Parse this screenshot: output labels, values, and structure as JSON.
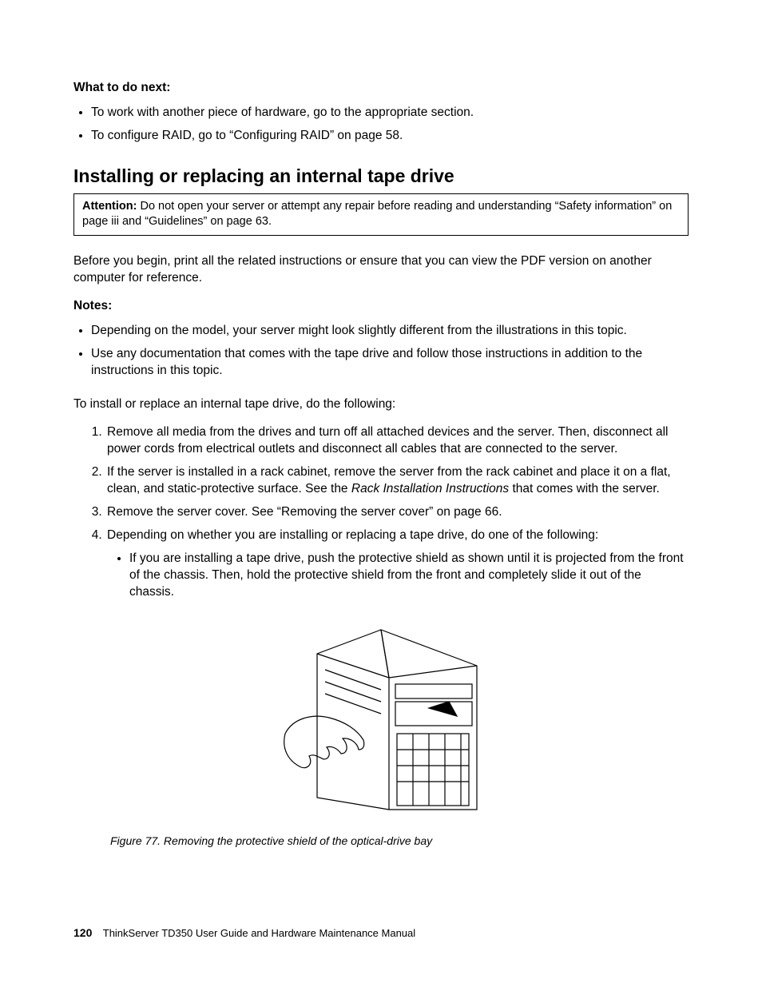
{
  "whatNext": {
    "heading": "What to do next:",
    "items": [
      "To work with another piece of hardware, go to the appropriate section.",
      "To configure RAID, go to “Configuring RAID” on page 58."
    ]
  },
  "mainHeading": "Installing or replacing an internal tape drive",
  "attention": {
    "label": "Attention:",
    "text": " Do not open your server or attempt any repair before reading and understanding “Safety information” on page iii and “Guidelines” on page 63."
  },
  "intro": "Before you begin, print all the related instructions or ensure that you can view the PDF version on another computer for reference.",
  "notes": {
    "heading": "Notes:",
    "items": [
      "Depending on the model, your server might look slightly different from the illustrations in this topic.",
      "Use any documentation that comes with the tape drive and follow those instructions in addition to the instructions in this topic."
    ]
  },
  "stepsIntro": "To install or replace an internal tape drive, do the following:",
  "steps": {
    "s1": "Remove all media from the drives and turn off all attached devices and the server. Then, disconnect all power cords from electrical outlets and disconnect all cables that are connected to the server.",
    "s2a": "If the server is installed in a rack cabinet, remove the server from the rack cabinet and place it on a flat, clean, and static-protective surface. See the ",
    "s2i": "Rack Installation Instructions",
    "s2b": " that comes with the server.",
    "s3": "Remove the server cover. See “Removing the server cover” on page 66.",
    "s4": "Depending on whether you are installing or replacing a tape drive, do one of the following:",
    "s4sub1": "If you are installing a tape drive, push the protective shield as shown until it is projected from the front of the chassis. Then, hold the protective shield from the front and completely slide it out of the chassis."
  },
  "figure": {
    "caption": "Figure 77.  Removing the protective shield of the optical-drive bay"
  },
  "footer": {
    "pageNumber": "120",
    "bookTitle": "ThinkServer TD350 User Guide and Hardware Maintenance Manual"
  }
}
